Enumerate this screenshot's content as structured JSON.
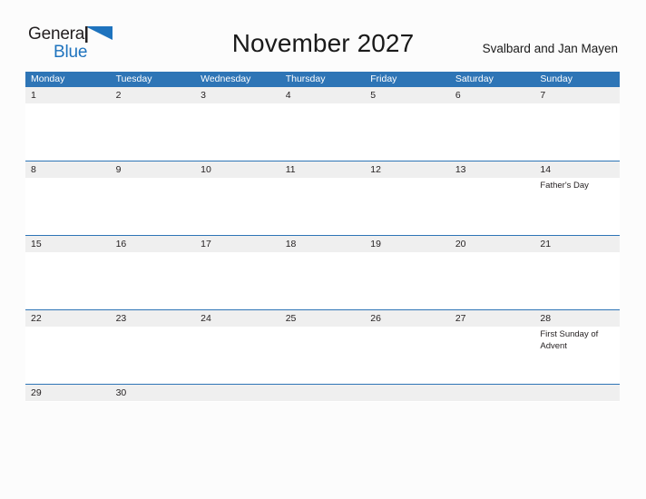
{
  "logo": {
    "word1": "General",
    "word2": "Blue",
    "flag_icon": "blue-flag-triangle",
    "accent_color": "#1e73be"
  },
  "header": {
    "title": "November 2027",
    "subtitle": "Svalbard and Jan Mayen"
  },
  "theme": {
    "header_blue": "#2e75b6",
    "band_gray": "#efefef",
    "page_background": "#fcfcfc",
    "text_color": "#231f20"
  },
  "calendar": {
    "month": "November",
    "year": "2027",
    "region": "Svalbard and Jan Mayen",
    "day_headers": [
      "Monday",
      "Tuesday",
      "Wednesday",
      "Thursday",
      "Friday",
      "Saturday",
      "Sunday"
    ],
    "weeks": [
      {
        "days": [
          {
            "num": "1",
            "events": []
          },
          {
            "num": "2",
            "events": []
          },
          {
            "num": "3",
            "events": []
          },
          {
            "num": "4",
            "events": []
          },
          {
            "num": "5",
            "events": []
          },
          {
            "num": "6",
            "events": []
          },
          {
            "num": "7",
            "events": []
          }
        ]
      },
      {
        "days": [
          {
            "num": "8",
            "events": []
          },
          {
            "num": "9",
            "events": []
          },
          {
            "num": "10",
            "events": []
          },
          {
            "num": "11",
            "events": []
          },
          {
            "num": "12",
            "events": []
          },
          {
            "num": "13",
            "events": []
          },
          {
            "num": "14",
            "events": [
              "Father's Day"
            ]
          }
        ]
      },
      {
        "days": [
          {
            "num": "15",
            "events": []
          },
          {
            "num": "16",
            "events": []
          },
          {
            "num": "17",
            "events": []
          },
          {
            "num": "18",
            "events": []
          },
          {
            "num": "19",
            "events": []
          },
          {
            "num": "20",
            "events": []
          },
          {
            "num": "21",
            "events": []
          }
        ]
      },
      {
        "days": [
          {
            "num": "22",
            "events": []
          },
          {
            "num": "23",
            "events": []
          },
          {
            "num": "24",
            "events": []
          },
          {
            "num": "25",
            "events": []
          },
          {
            "num": "26",
            "events": []
          },
          {
            "num": "27",
            "events": []
          },
          {
            "num": "28",
            "events": [
              "First Sunday of Advent"
            ]
          }
        ]
      },
      {
        "days": [
          {
            "num": "29",
            "events": []
          },
          {
            "num": "30",
            "events": []
          },
          {
            "num": "",
            "events": []
          },
          {
            "num": "",
            "events": []
          },
          {
            "num": "",
            "events": []
          },
          {
            "num": "",
            "events": []
          },
          {
            "num": "",
            "events": []
          }
        ]
      }
    ]
  }
}
